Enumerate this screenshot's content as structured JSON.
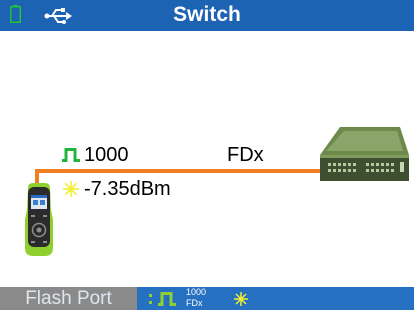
{
  "title": "Switch",
  "icons": {
    "status": [
      "battery-icon",
      "usb-icon"
    ],
    "link": [
      "pulse-icon",
      "sun-icon",
      "tester-device-icon",
      "network-switch-icon"
    ]
  },
  "link": {
    "speed": "1000",
    "duplex": "FDx",
    "power": "-7.35dBm"
  },
  "footer": {
    "flash_port_label": "Flash Port",
    "speed": "1000",
    "duplex": "FDx"
  },
  "colors": {
    "title_bar": "#1c63b3",
    "link_line": "#f07e22",
    "link_indicator": "#22b43a",
    "power_indicator": "#f2ee34",
    "footer_bar": "#2570c0",
    "flash_button": "#8a8a8a"
  }
}
